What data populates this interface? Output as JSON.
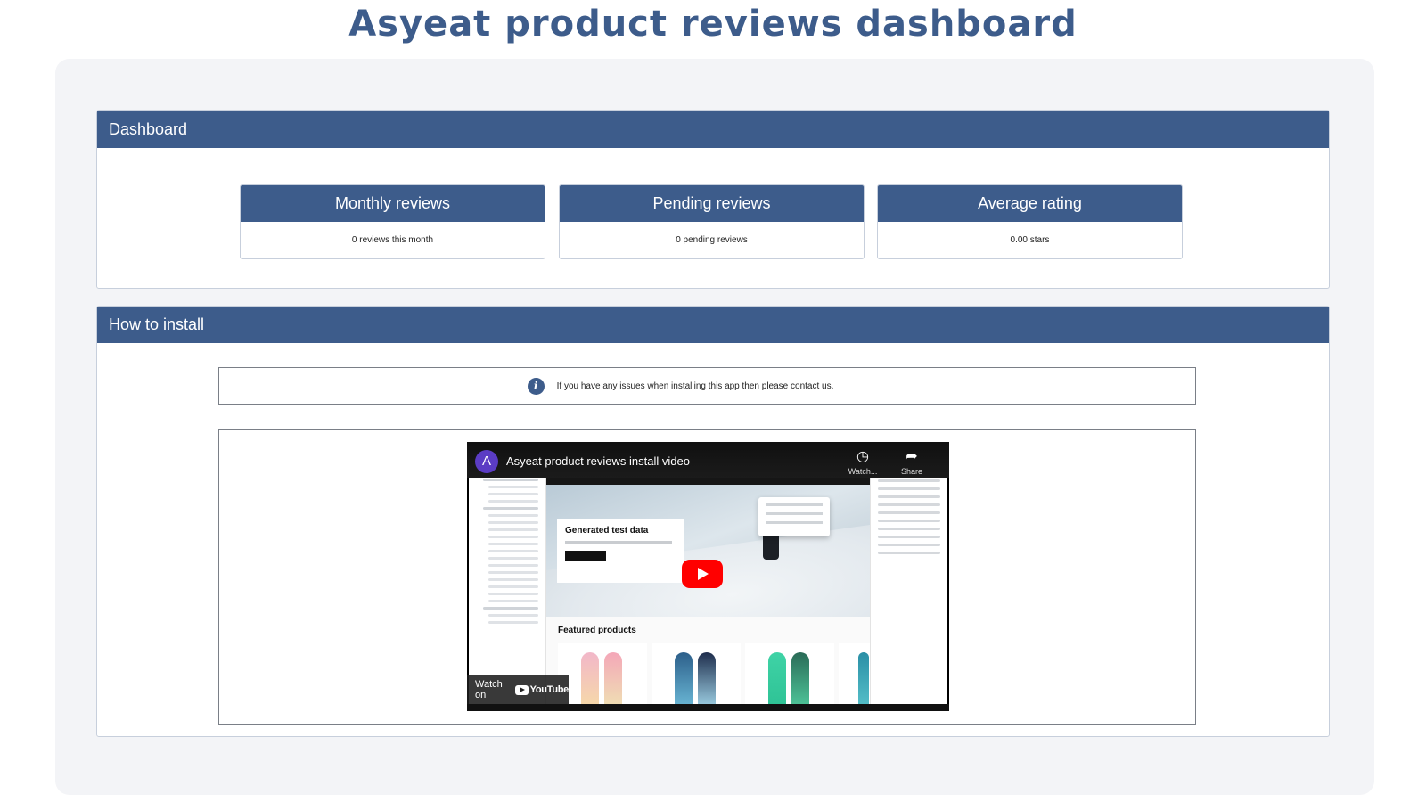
{
  "page": {
    "title": "Asyeat product reviews dashboard"
  },
  "dashboard": {
    "header": "Dashboard",
    "cards": [
      {
        "title": "Monthly reviews",
        "value": "0 reviews this month"
      },
      {
        "title": "Pending reviews",
        "value": "0 pending reviews"
      },
      {
        "title": "Average rating",
        "value": "0.00 stars"
      }
    ]
  },
  "install": {
    "header": "How to install",
    "info_icon": "info-icon",
    "info_text": "If you have any issues when installing this app then please contact us.",
    "video": {
      "channel_initial": "A",
      "title": "Asyeat product reviews install video",
      "watch_later_label": "Watch...",
      "share_label": "Share",
      "hero_heading": "Generated test data",
      "featured_heading": "Featured products",
      "watch_on_label": "Watch on",
      "youtube_label": "YouTube"
    }
  },
  "colors": {
    "brand": "#3d5c8b",
    "youtube_red": "#ff0000",
    "card_background": "#f3f4f7"
  }
}
